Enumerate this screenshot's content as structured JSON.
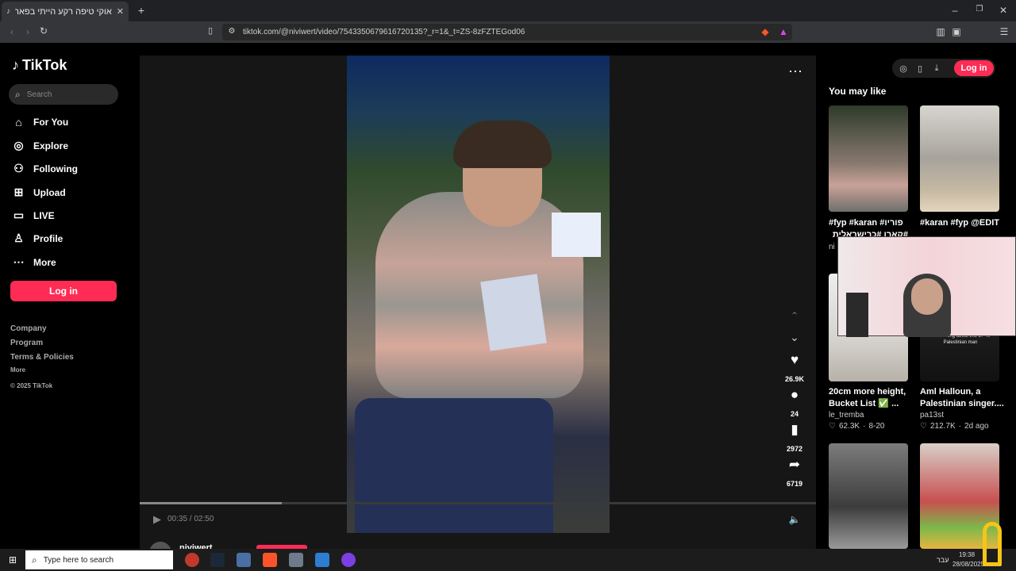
{
  "browser": {
    "tab_title": "אוקי טיפה רקע הייתי בפארק כל",
    "url": "tiktok.com/@niviwert/video/7543350679616720135?_r=1&_t=ZS-8zFZTEGod06"
  },
  "sidebar": {
    "logo": "TikTok",
    "search_placeholder": "Search",
    "items": [
      {
        "label": "For You",
        "icon": "home-icon"
      },
      {
        "label": "Explore",
        "icon": "compass-icon"
      },
      {
        "label": "Following",
        "icon": "following-icon"
      },
      {
        "label": "Upload",
        "icon": "plus-square-icon"
      },
      {
        "label": "LIVE",
        "icon": "live-tv-icon"
      },
      {
        "label": "Profile",
        "icon": "person-icon"
      },
      {
        "label": "More",
        "icon": "more-dots-icon"
      }
    ],
    "login_label": "Log in",
    "footer": {
      "company": "Company",
      "program": "Program",
      "terms": "Terms & Policies",
      "more": "More",
      "copyright": "© 2025 TikTok"
    }
  },
  "video": {
    "time": "00:35 / 02:50",
    "progress": 0.21,
    "likes": "26.9K",
    "comments": "24",
    "saves": "2972",
    "shares": "6719",
    "author": "niviwert"
  },
  "right_panel": {
    "login_label": "Log in",
    "heading": "You may like",
    "cards": [
      {
        "caption": "#fyp #karan #פוריו",
        "caption2": "#קארן #כרישראלית",
        "author": "ni",
        "likes": "",
        "date": ""
      },
      {
        "caption": "#karan #fyp @EDITS",
        "caption2": "",
        "author": "",
        "likes": "",
        "date": ""
      },
      {
        "caption": "20cm more height,",
        "caption2": "Bucket List ✅ ...",
        "author": "le_tremba",
        "likes": "62.3K",
        "date": "8-20"
      },
      {
        "caption": "Aml Halloun, a",
        "caption2": "Palestinian singer....",
        "author": "pa13st",
        "likes": "212.7K",
        "date": "2d ago"
      }
    ],
    "overlay_text": "Some thing about this 17 40 Palestinian man"
  },
  "taskbar": {
    "search_placeholder": "Type here to search",
    "lang": "עבר",
    "time": "19:38",
    "date": "28/08/2025"
  },
  "colors": {
    "accent": "#fe2c55",
    "bg": "#000000",
    "panel": "#121212"
  }
}
